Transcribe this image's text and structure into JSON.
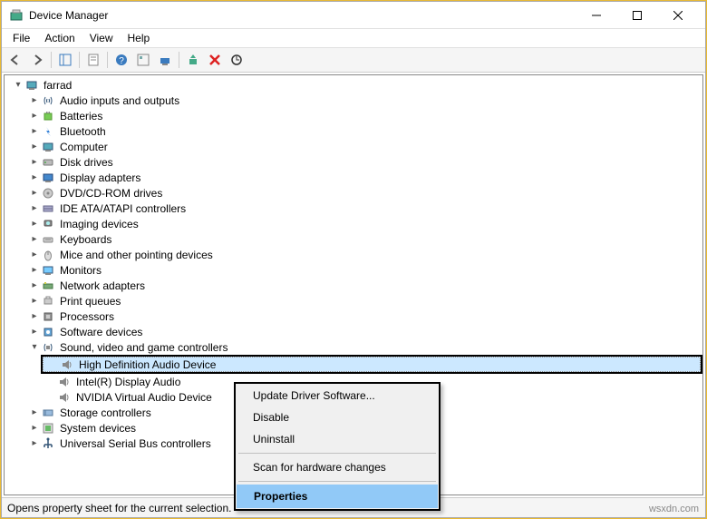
{
  "window": {
    "title": "Device Manager"
  },
  "menubar": {
    "file": "File",
    "action": "Action",
    "view": "View",
    "help": "Help"
  },
  "tree": {
    "root": "farrad",
    "items": [
      "Audio inputs and outputs",
      "Batteries",
      "Bluetooth",
      "Computer",
      "Disk drives",
      "Display adapters",
      "DVD/CD-ROM drives",
      "IDE ATA/ATAPI controllers",
      "Imaging devices",
      "Keyboards",
      "Mice and other pointing devices",
      "Monitors",
      "Network adapters",
      "Print queues",
      "Processors",
      "Software devices",
      "Sound, video and game controllers",
      "Storage controllers",
      "System devices",
      "Universal Serial Bus controllers"
    ],
    "sound_children": [
      "High Definition Audio Device",
      "Intel(R) Display Audio",
      "NVIDIA Virtual Audio Device"
    ]
  },
  "context_menu": {
    "update": "Update Driver Software...",
    "disable": "Disable",
    "uninstall": "Uninstall",
    "scan": "Scan for hardware changes",
    "properties": "Properties"
  },
  "statusbar": {
    "text": "Opens property sheet for the current selection."
  },
  "watermark": "wsxdn.com"
}
